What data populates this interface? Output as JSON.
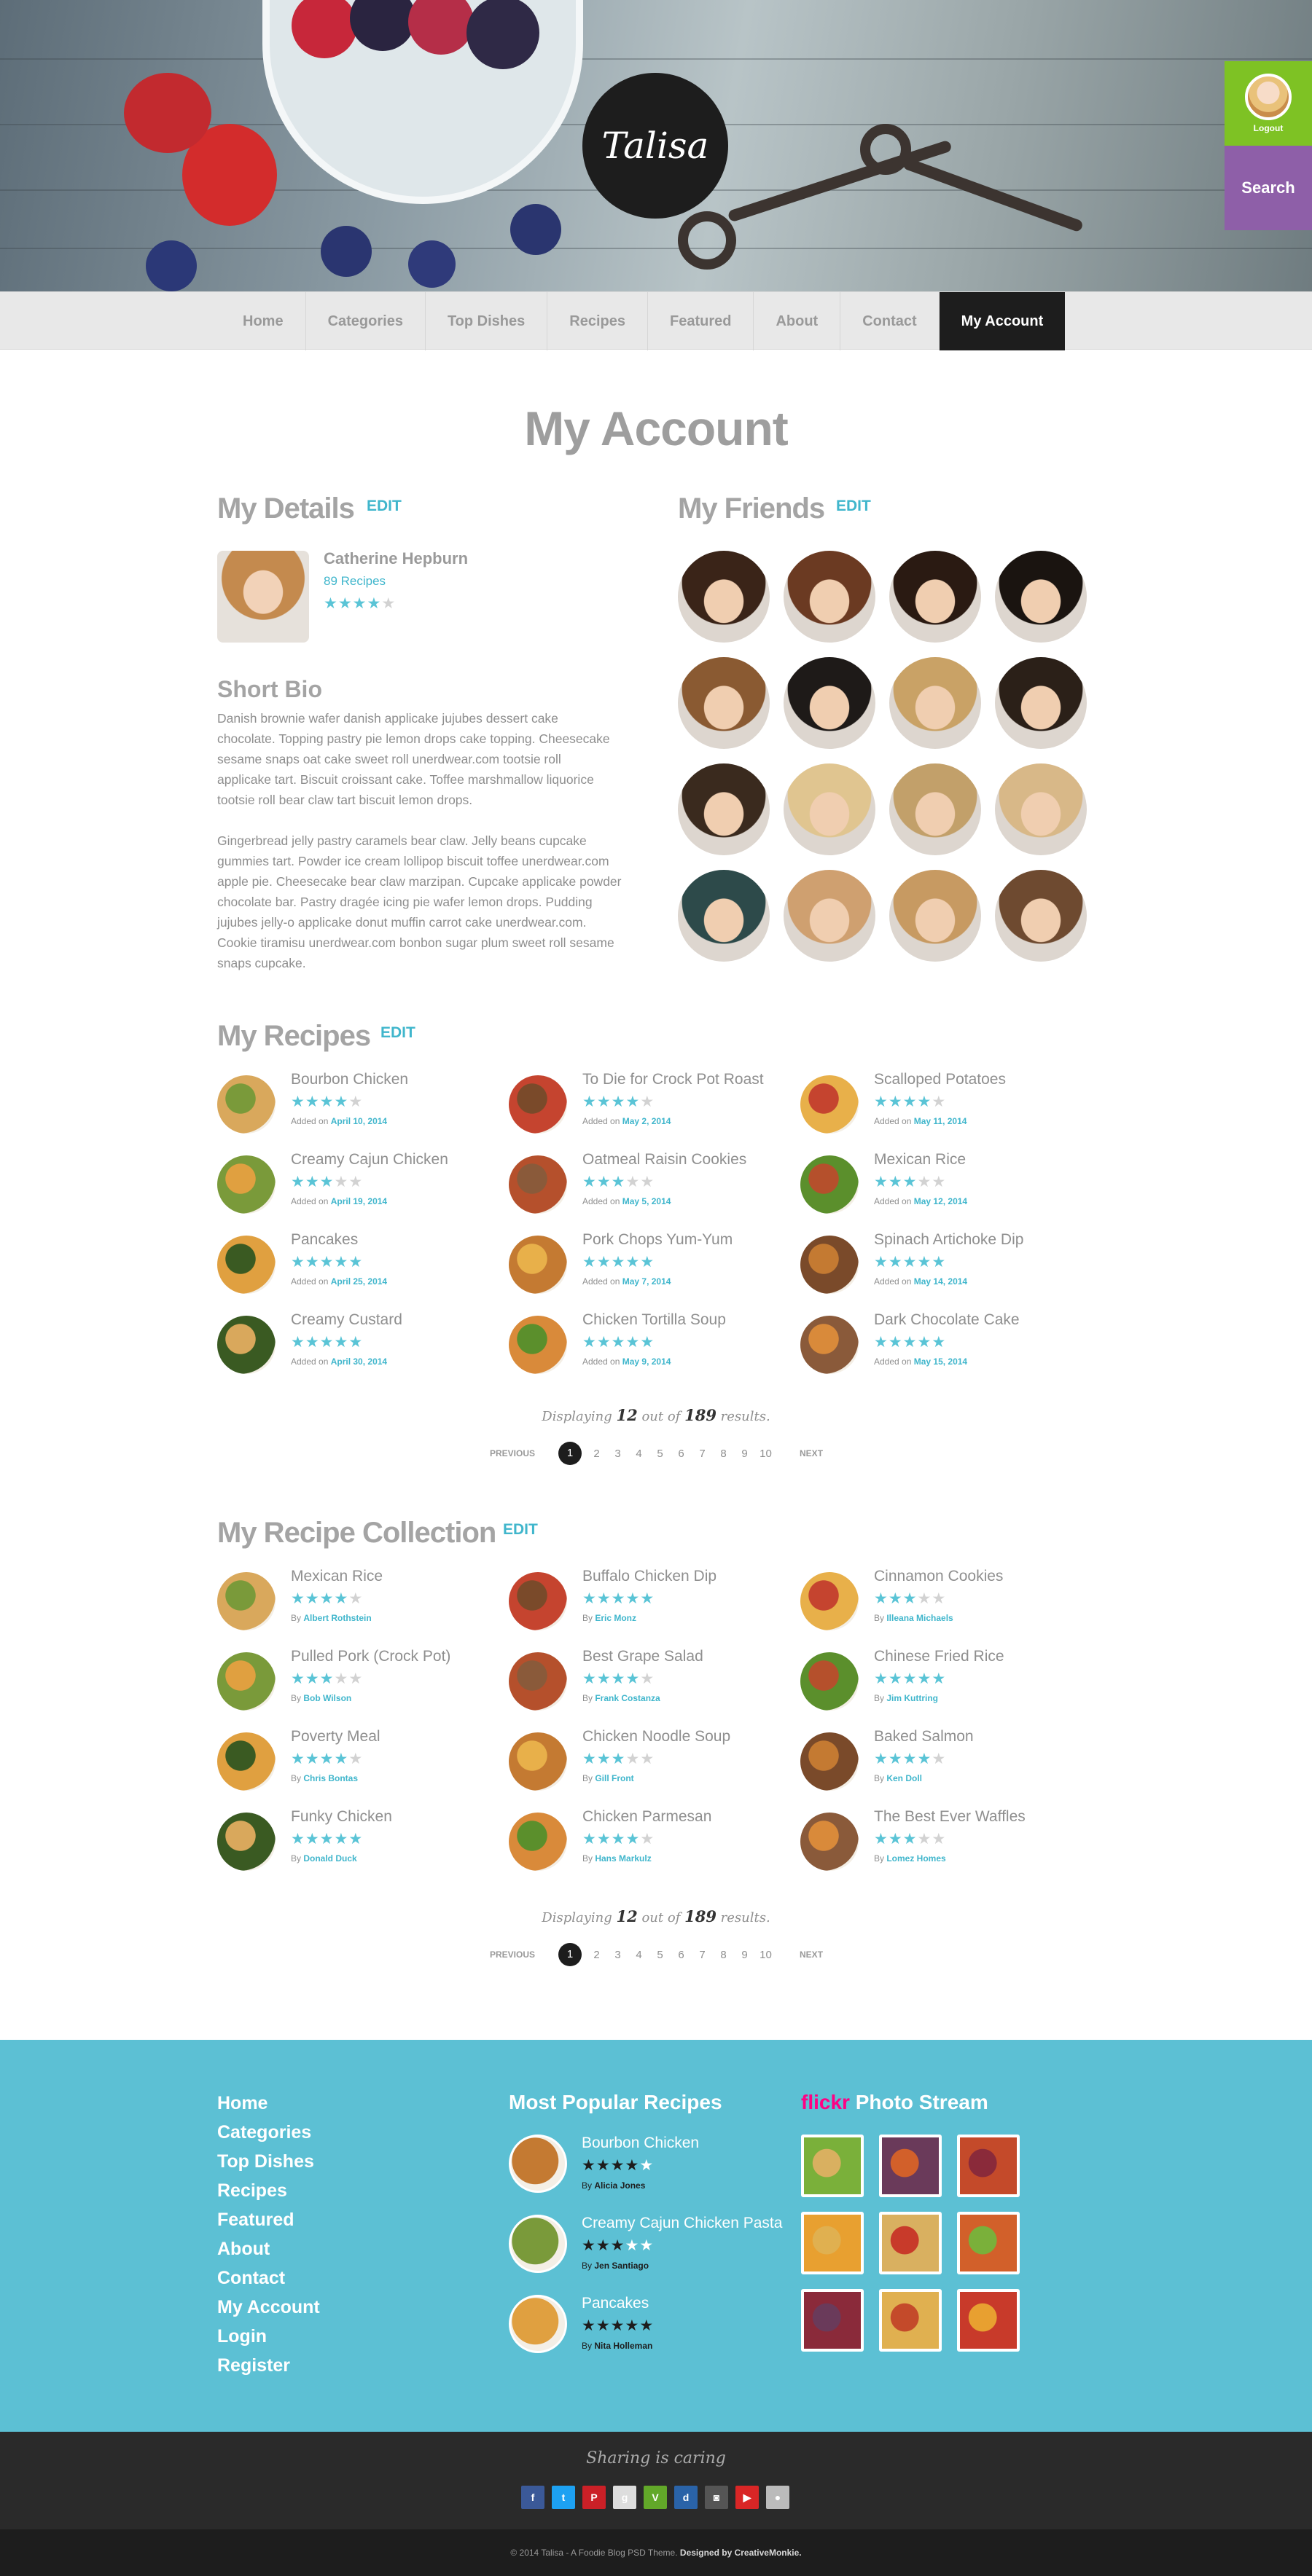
{
  "brand": {
    "logo_text": "Talisa"
  },
  "side": {
    "logout_label": "Logout",
    "search_label": "Search"
  },
  "nav": {
    "items": [
      "Home",
      "Categories",
      "Top Dishes",
      "Recipes",
      "Featured",
      "About",
      "Contact",
      "My Account"
    ],
    "active": "My Account"
  },
  "page": {
    "title": "My Account"
  },
  "details": {
    "title": "My Details",
    "edit": "EDIT",
    "name": "Catherine Hepburn",
    "recipes": "89 Recipes",
    "rating": 4
  },
  "friends": {
    "title": "My Friends",
    "edit": "EDIT",
    "count": 16
  },
  "bio": {
    "title": "Short Bio",
    "p1": [
      "Danish brownie wafer danish applicake jujubes dessert cake",
      "chocolate. Topping pastry pie lemon drops cake topping. Cheesecake",
      "sesame snaps oat cake sweet roll unerdwear.com tootsie roll",
      "applicake tart. Biscuit croissant cake. Toffee marshmallow liquorice",
      "tootsie roll bear claw tart biscuit lemon drops."
    ],
    "p2": [
      "Gingerbread jelly pastry caramels bear claw. Jelly beans cupcake",
      "gummies tart. Powder ice cream lollipop biscuit toffee unerdwear.com",
      "apple pie. Cheesecake bear claw marzipan. Cupcake applicake powder",
      "chocolate bar. Pastry dragée icing pie wafer lemon drops. Pudding",
      "jujubes jelly-o applicake donut muffin carrot cake unerdwear.com.",
      "Cookie tiramisu unerdwear.com bonbon sugar plum sweet roll sesame",
      "snaps cupcake."
    ]
  },
  "recipes": {
    "title": "My Recipes",
    "edit": "EDIT",
    "meta_prefix": "Added on",
    "items": [
      {
        "name": "Bourbon Chicken",
        "rating": 4,
        "date": "April 10, 2014"
      },
      {
        "name": "To Die for Crock Pot Roast",
        "rating": 4,
        "date": "May 2, 2014"
      },
      {
        "name": "Scalloped Potatoes",
        "rating": 4,
        "date": "May 11, 2014"
      },
      {
        "name": "Creamy Cajun Chicken",
        "rating": 3,
        "date": "April 19, 2014"
      },
      {
        "name": "Oatmeal Raisin Cookies",
        "rating": 3,
        "date": "May 5, 2014"
      },
      {
        "name": "Mexican Rice",
        "rating": 3,
        "date": "May 12, 2014"
      },
      {
        "name": "Pancakes",
        "rating": 5,
        "date": "April 25, 2014"
      },
      {
        "name": "Pork Chops Yum-Yum",
        "rating": 5,
        "date": "May 7, 2014"
      },
      {
        "name": "Spinach Artichoke Dip",
        "rating": 5,
        "date": "May 14, 2014"
      },
      {
        "name": "Creamy Custard",
        "rating": 5,
        "date": "April 30, 2014"
      },
      {
        "name": "Chicken Tortilla Soup",
        "rating": 5,
        "date": "May 9, 2014"
      },
      {
        "name": "Dark Chocolate Cake",
        "rating": 5,
        "date": "May 15, 2014"
      }
    ],
    "display": {
      "pre": "Displaying",
      "shown": "12",
      "mid": "out of",
      "total": "189",
      "post": "results."
    }
  },
  "collection": {
    "title": "My Recipe Collection",
    "edit": "EDIT",
    "meta_prefix": "By",
    "items": [
      {
        "name": "Mexican Rice",
        "rating": 4,
        "by": "Albert Rothstein"
      },
      {
        "name": "Buffalo Chicken Dip",
        "rating": 5,
        "by": "Eric Monz"
      },
      {
        "name": "Cinnamon Cookies",
        "rating": 3,
        "by": "Illeana Michaels"
      },
      {
        "name": "Pulled Pork (Crock Pot)",
        "rating": 3,
        "by": "Bob Wilson"
      },
      {
        "name": "Best Grape Salad",
        "rating": 4,
        "by": "Frank Costanza"
      },
      {
        "name": "Chinese Fried Rice",
        "rating": 5,
        "by": "Jim Kuttring"
      },
      {
        "name": "Poverty Meal",
        "rating": 4,
        "by": "Chris Bontas"
      },
      {
        "name": "Chicken Noodle Soup",
        "rating": 3,
        "by": "Gill Front"
      },
      {
        "name": "Baked Salmon",
        "rating": 4,
        "by": "Ken Doll"
      },
      {
        "name": "Funky Chicken",
        "rating": 5,
        "by": "Donald Duck"
      },
      {
        "name": "Chicken Parmesan",
        "rating": 4,
        "by": "Hans Markulz"
      },
      {
        "name": "The Best Ever Waffles",
        "rating": 3,
        "by": "Lomez Homes"
      }
    ],
    "display": {
      "pre": "Displaying",
      "shown": "12",
      "mid": "out of",
      "total": "189",
      "post": "results."
    }
  },
  "pagination": {
    "prev": "PREVIOUS",
    "next": "NEXT",
    "pages": [
      "1",
      "2",
      "3",
      "4",
      "5",
      "6",
      "7",
      "8",
      "9",
      "10"
    ],
    "current": "1"
  },
  "footer": {
    "links": [
      "Home",
      "Categories",
      "Top Dishes",
      "Recipes",
      "Featured",
      "About",
      "Contact",
      "My Account",
      "Login",
      "Register"
    ],
    "popular_title": "Most Popular Recipes",
    "popular": [
      {
        "name": "Bourbon Chicken",
        "rating": 4,
        "by": "Alicia Jones"
      },
      {
        "name": "Creamy Cajun Chicken Pasta",
        "rating": 3,
        "by": "Jen Santiago"
      },
      {
        "name": "Pancakes",
        "rating": 5,
        "by": "Nita Holleman"
      }
    ],
    "flickr_word_1": "flick",
    "flickr_word_2": "r",
    "photostream": "Photo Stream"
  },
  "bottom": {
    "caring": "Sharing is caring",
    "socials": [
      {
        "icon": "facebook-icon",
        "glyph": "f",
        "color": "#3b5998"
      },
      {
        "icon": "twitter-icon",
        "glyph": "t",
        "color": "#1da1f2"
      },
      {
        "icon": "pinterest-icon",
        "glyph": "P",
        "color": "#cb2027"
      },
      {
        "icon": "google-icon",
        "glyph": "g",
        "color": "#dddddd"
      },
      {
        "icon": "vine-icon",
        "glyph": "V",
        "color": "#62a829"
      },
      {
        "icon": "digg-icon",
        "glyph": "d",
        "color": "#2a63a8"
      },
      {
        "icon": "instagram-icon",
        "glyph": "◙",
        "color": "#555555"
      },
      {
        "icon": "youtube-icon",
        "glyph": "▶",
        "color": "#d92626"
      },
      {
        "icon": "flickr-icon",
        "glyph": "●",
        "color": "#bbbbbb"
      }
    ],
    "copyright": "© 2014 Talisa - A Foodie Blog PSD Theme.",
    "designed": "Designed by CreativeMonkie."
  },
  "colors": {
    "accent": "#5cc0d4",
    "login": "#7ec224",
    "search": "#8e5fa8",
    "dark": "#1d1d1d"
  }
}
